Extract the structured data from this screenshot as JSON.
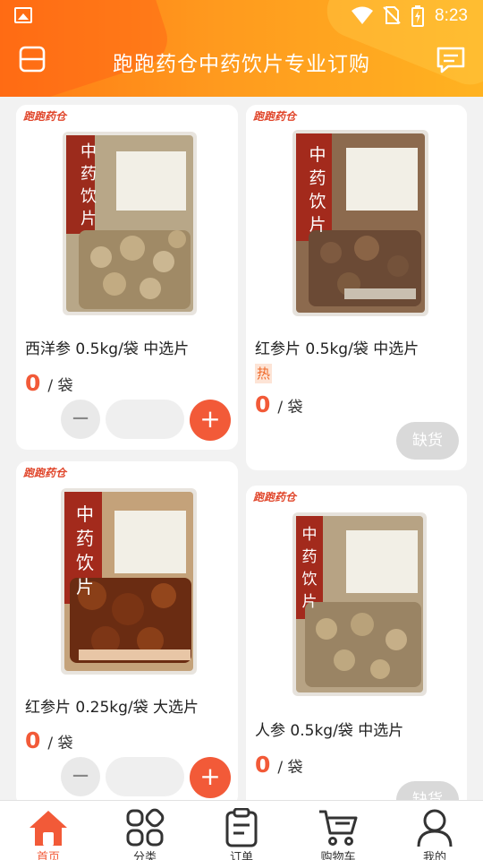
{
  "status_bar": {
    "time": "8:23"
  },
  "header": {
    "title": "跑跑药仓中药饮片专业订购"
  },
  "brand_mark": "跑跑药仓",
  "products": [
    {
      "name": "西洋参 0.5kg/袋 中选片",
      "price": "0",
      "unit": "/ 袋",
      "hot": "",
      "status": "stepper",
      "package_label": "中药饮片"
    },
    {
      "name": "红参片 0.5kg/袋 中选片",
      "price": "0",
      "unit": "/ 袋",
      "hot": "热",
      "status": "缺货",
      "package_label": "中药饮片"
    },
    {
      "name": "红参片 0.25kg/袋 大选片",
      "price": "0",
      "unit": "/ 袋",
      "hot": "",
      "status": "stepper",
      "package_label": "中药饮片"
    },
    {
      "name": "人参 0.5kg/袋 中选片",
      "price": "0",
      "unit": "/ 袋",
      "hot": "",
      "status": "缺货",
      "package_label": "中药饮片"
    }
  ],
  "stepper": {
    "minus": "−",
    "plus": "+"
  },
  "nav": [
    {
      "label": "首页",
      "icon": "home-icon",
      "active": true
    },
    {
      "label": "分类",
      "icon": "category-icon",
      "active": false
    },
    {
      "label": "订单",
      "icon": "order-icon",
      "active": false
    },
    {
      "label": "购物车",
      "icon": "cart-icon",
      "active": false
    },
    {
      "label": "我的",
      "icon": "user-icon",
      "active": false
    }
  ],
  "colors": {
    "accent": "#f25a38",
    "header_start": "#ff7a14",
    "header_end": "#ffb321"
  }
}
